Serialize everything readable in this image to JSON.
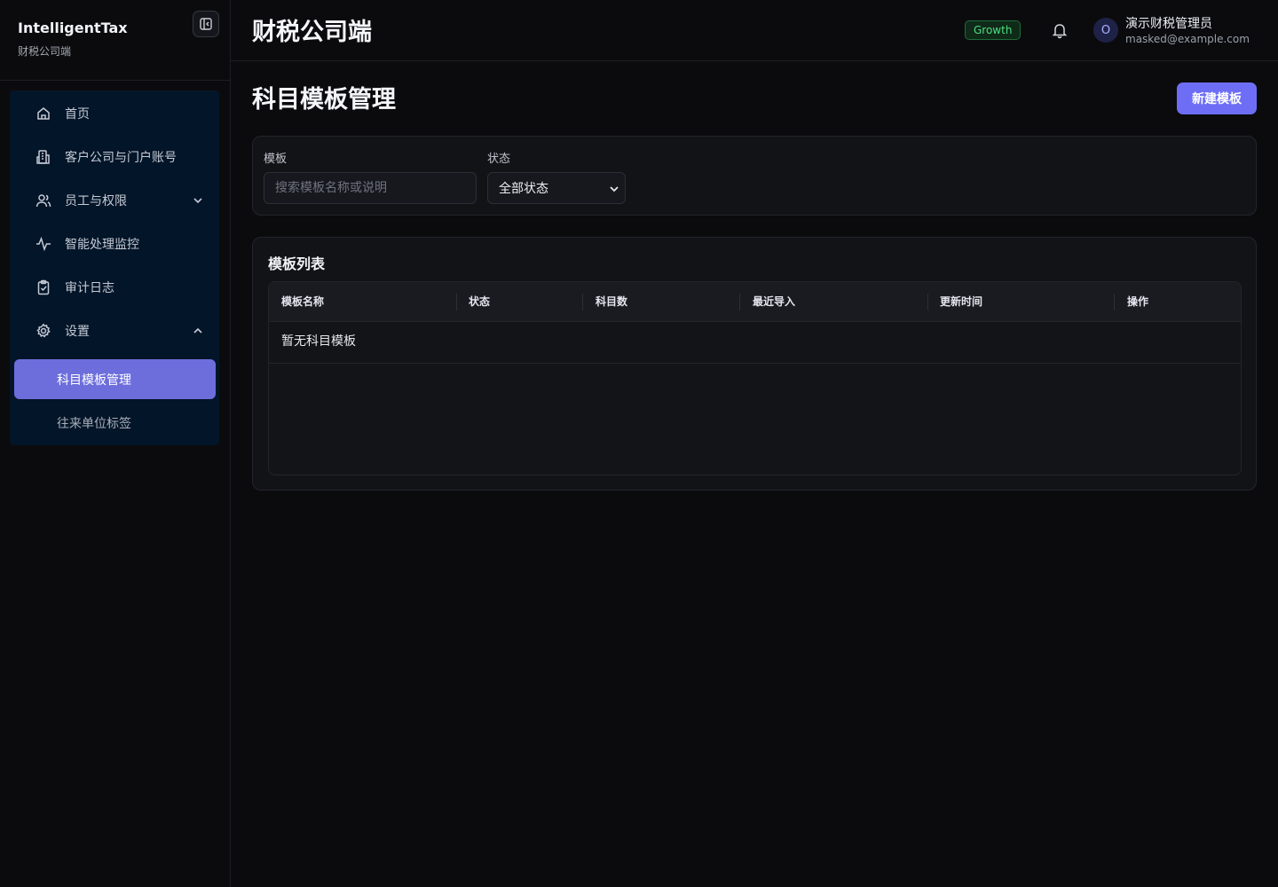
{
  "sidebar": {
    "brand_name": "IntelligentTax",
    "brand_sub": "财税公司端",
    "items": [
      {
        "label": "首页",
        "icon": "home-icon"
      },
      {
        "label": "客户公司与门户账号",
        "icon": "building-icon"
      },
      {
        "label": "员工与权限",
        "icon": "users-icon"
      },
      {
        "label": "智能处理监控",
        "icon": "activity-icon"
      },
      {
        "label": "审计日志",
        "icon": "clipboard-check-icon"
      },
      {
        "label": "设置",
        "icon": "gear-icon"
      }
    ],
    "sub_items": [
      {
        "label": "科目模板管理",
        "active": true
      },
      {
        "label": "往来单位标签",
        "active": false
      }
    ]
  },
  "header": {
    "title": "财税公司端",
    "plan_badge": "Growth",
    "avatar_initial": "O",
    "user_name": "演示财税管理员",
    "user_email": "masked@example.com"
  },
  "main": {
    "page_title": "科目模板管理",
    "new_button": "新建模板",
    "filters": {
      "template_label": "模板",
      "search_placeholder": "搜索模板名称或说明",
      "status_label": "状态",
      "status_value": "全部状态"
    },
    "list": {
      "title": "模板列表",
      "columns": [
        "模板名称",
        "状态",
        "科目数",
        "最近导入",
        "更新时间",
        "操作"
      ],
      "empty_text": "暂无科目模板"
    }
  },
  "colors": {
    "accent": "#6d6ef5",
    "active_nav": "#6d6edc",
    "nav_panel": "#031528",
    "growth_badge": "#4fdc7e"
  }
}
